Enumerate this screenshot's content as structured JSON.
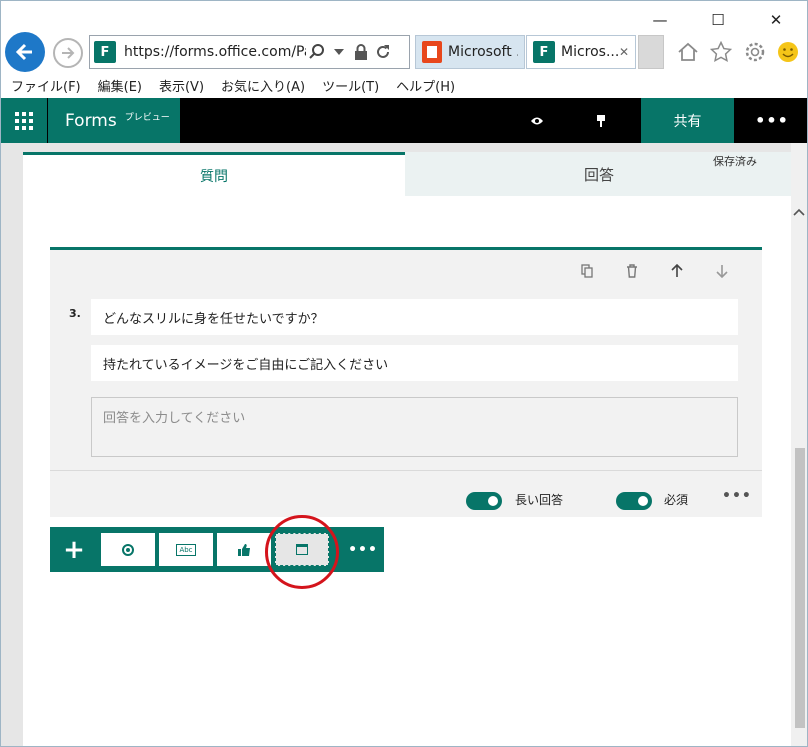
{
  "window": {
    "minimize": "—",
    "maximize": "☐",
    "close": "✕"
  },
  "browser": {
    "url": "https://forms.office.com/Pa",
    "tabs": [
      {
        "label": "Microsoft ...",
        "icon": "office-icon"
      },
      {
        "label": "Micros...",
        "icon": "forms-icon",
        "close": "✕"
      }
    ]
  },
  "menu": [
    "ファイル(F)",
    "編集(E)",
    "表示(V)",
    "お気に入り(A)",
    "ツール(T)",
    "ヘルプ(H)"
  ],
  "app": {
    "name": "Forms",
    "badge": "プレビュー",
    "share": "共有",
    "more": "•••"
  },
  "tabs": {
    "questions": "質問",
    "responses": "回答",
    "status": "保存済み"
  },
  "question": {
    "number": "3.",
    "title": "どんなスリルに身を任せたいですか？",
    "subtitle": "持たれているイメージをご自由にご記入ください",
    "answer_placeholder": "回答を入力してください",
    "long_answer_label": "長い回答",
    "long_answer_on": true,
    "required_label": "必須",
    "required_on": true,
    "more": "•••"
  },
  "add_bar": {
    "plus": "+",
    "more": "•••",
    "buttons": [
      "choice",
      "text",
      "rating",
      "date"
    ],
    "selected": "date",
    "abc_text": "Abc"
  },
  "colors": {
    "accent": "#077568",
    "highlight_circle": "#d4141c"
  }
}
